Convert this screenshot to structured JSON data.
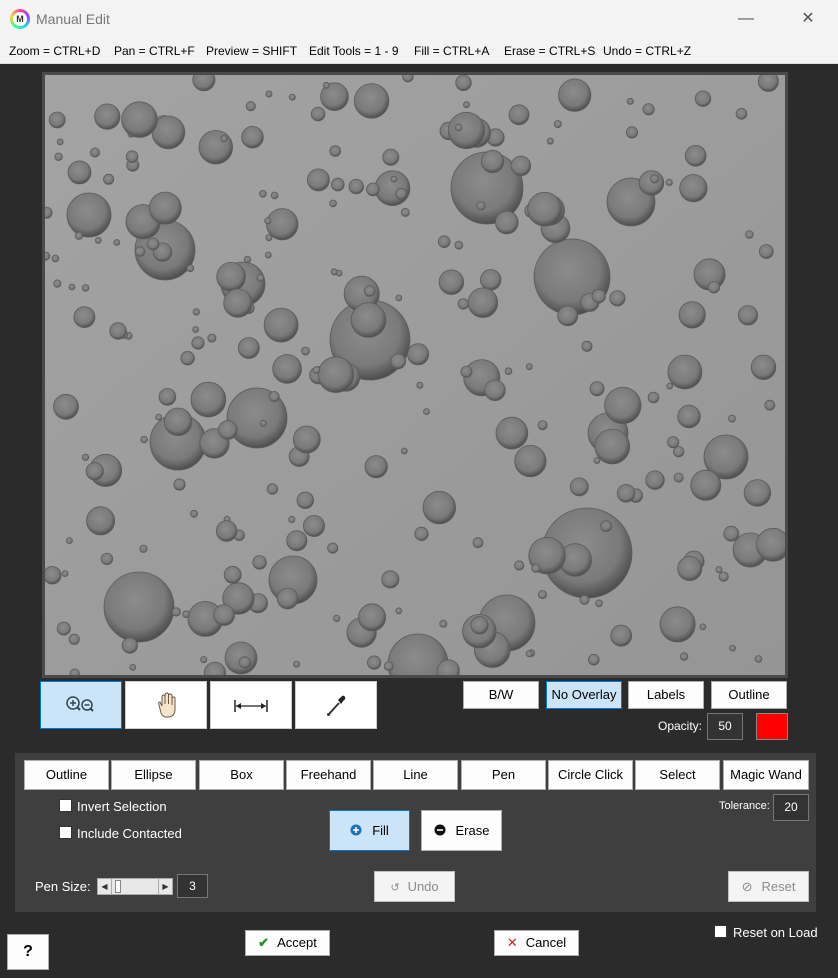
{
  "window": {
    "title": "Manual Edit",
    "app_icon_letter": "M",
    "minimize_glyph": "—",
    "maximize_glyph": "☐",
    "close_glyph": "✕"
  },
  "menu": [
    "Zoom = CTRL+D",
    "Pan = CTRL+F",
    "Preview = SHIFT",
    "Edit Tools = 1 - 9",
    "Fill = CTRL+A",
    "Erase = CTRL+S",
    "Undo = CTRL+Z"
  ],
  "view_tools": [
    {
      "name": "zoom",
      "icon": "zoom-in-out-icon",
      "active": true
    },
    {
      "name": "pan",
      "icon": "hand-icon",
      "active": false
    },
    {
      "name": "measure",
      "icon": "ruler-icon",
      "active": false
    },
    {
      "name": "dropper",
      "icon": "eyedropper-icon",
      "active": false
    }
  ],
  "overlay": {
    "buttons": [
      "B/W",
      "No Overlay",
      "Labels",
      "Outline"
    ],
    "active": "No Overlay",
    "opacity_label": "Opacity:",
    "opacity_value": "50",
    "color": "#ff0000"
  },
  "edit_tools": [
    "Outline",
    "Ellipse",
    "Box",
    "Freehand",
    "Line",
    "Pen",
    "Circle Click",
    "Select",
    "Magic Wand"
  ],
  "options": {
    "invert_selection": {
      "label": "Invert Selection",
      "checked": false
    },
    "include_contacted": {
      "label": "Include Contacted",
      "checked": false
    }
  },
  "fill_label": "Fill",
  "erase_label": "Erase",
  "tolerance_label": "Tolerance:",
  "tolerance_value": "20",
  "pen_size_label": "Pen Size:",
  "pen_size_value": "3",
  "undo_label": "Undo",
  "reset_label": "Reset",
  "help_label": "?",
  "accept_label": "Accept",
  "cancel_label": "Cancel",
  "reset_on_load": {
    "label": "Reset on Load",
    "checked": false
  },
  "colors": {
    "accept_check": "#2e8b2e",
    "cancel_x": "#d11a2a",
    "fill_icon": "#1f6fbf"
  }
}
